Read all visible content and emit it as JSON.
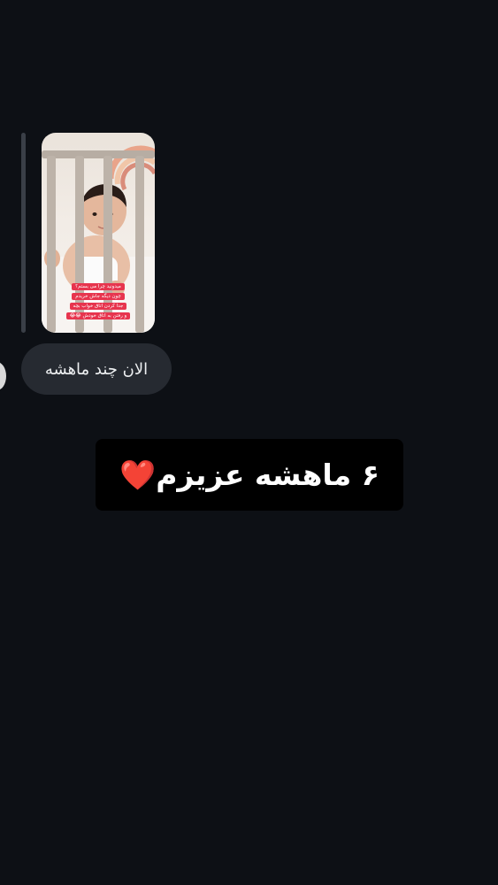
{
  "story_reply": {
    "image_captions": [
      "میدونید چرا می بستم؟",
      "چون دیگه جاش خریدم",
      "جدا کردن اتاق خواب بچه",
      "و رفتن به اتاق خودش 😂😂"
    ],
    "image_subject": "baby-in-crib-photo"
  },
  "message": {
    "text": "الان چند ماهشه"
  },
  "overlay_caption": {
    "text": "۶ ماهشه عزیزم❤️"
  },
  "colors": {
    "background": "#0d1015",
    "bubble": "#262a31",
    "caption_box": "#000000",
    "caption_label": "#e7354e"
  }
}
